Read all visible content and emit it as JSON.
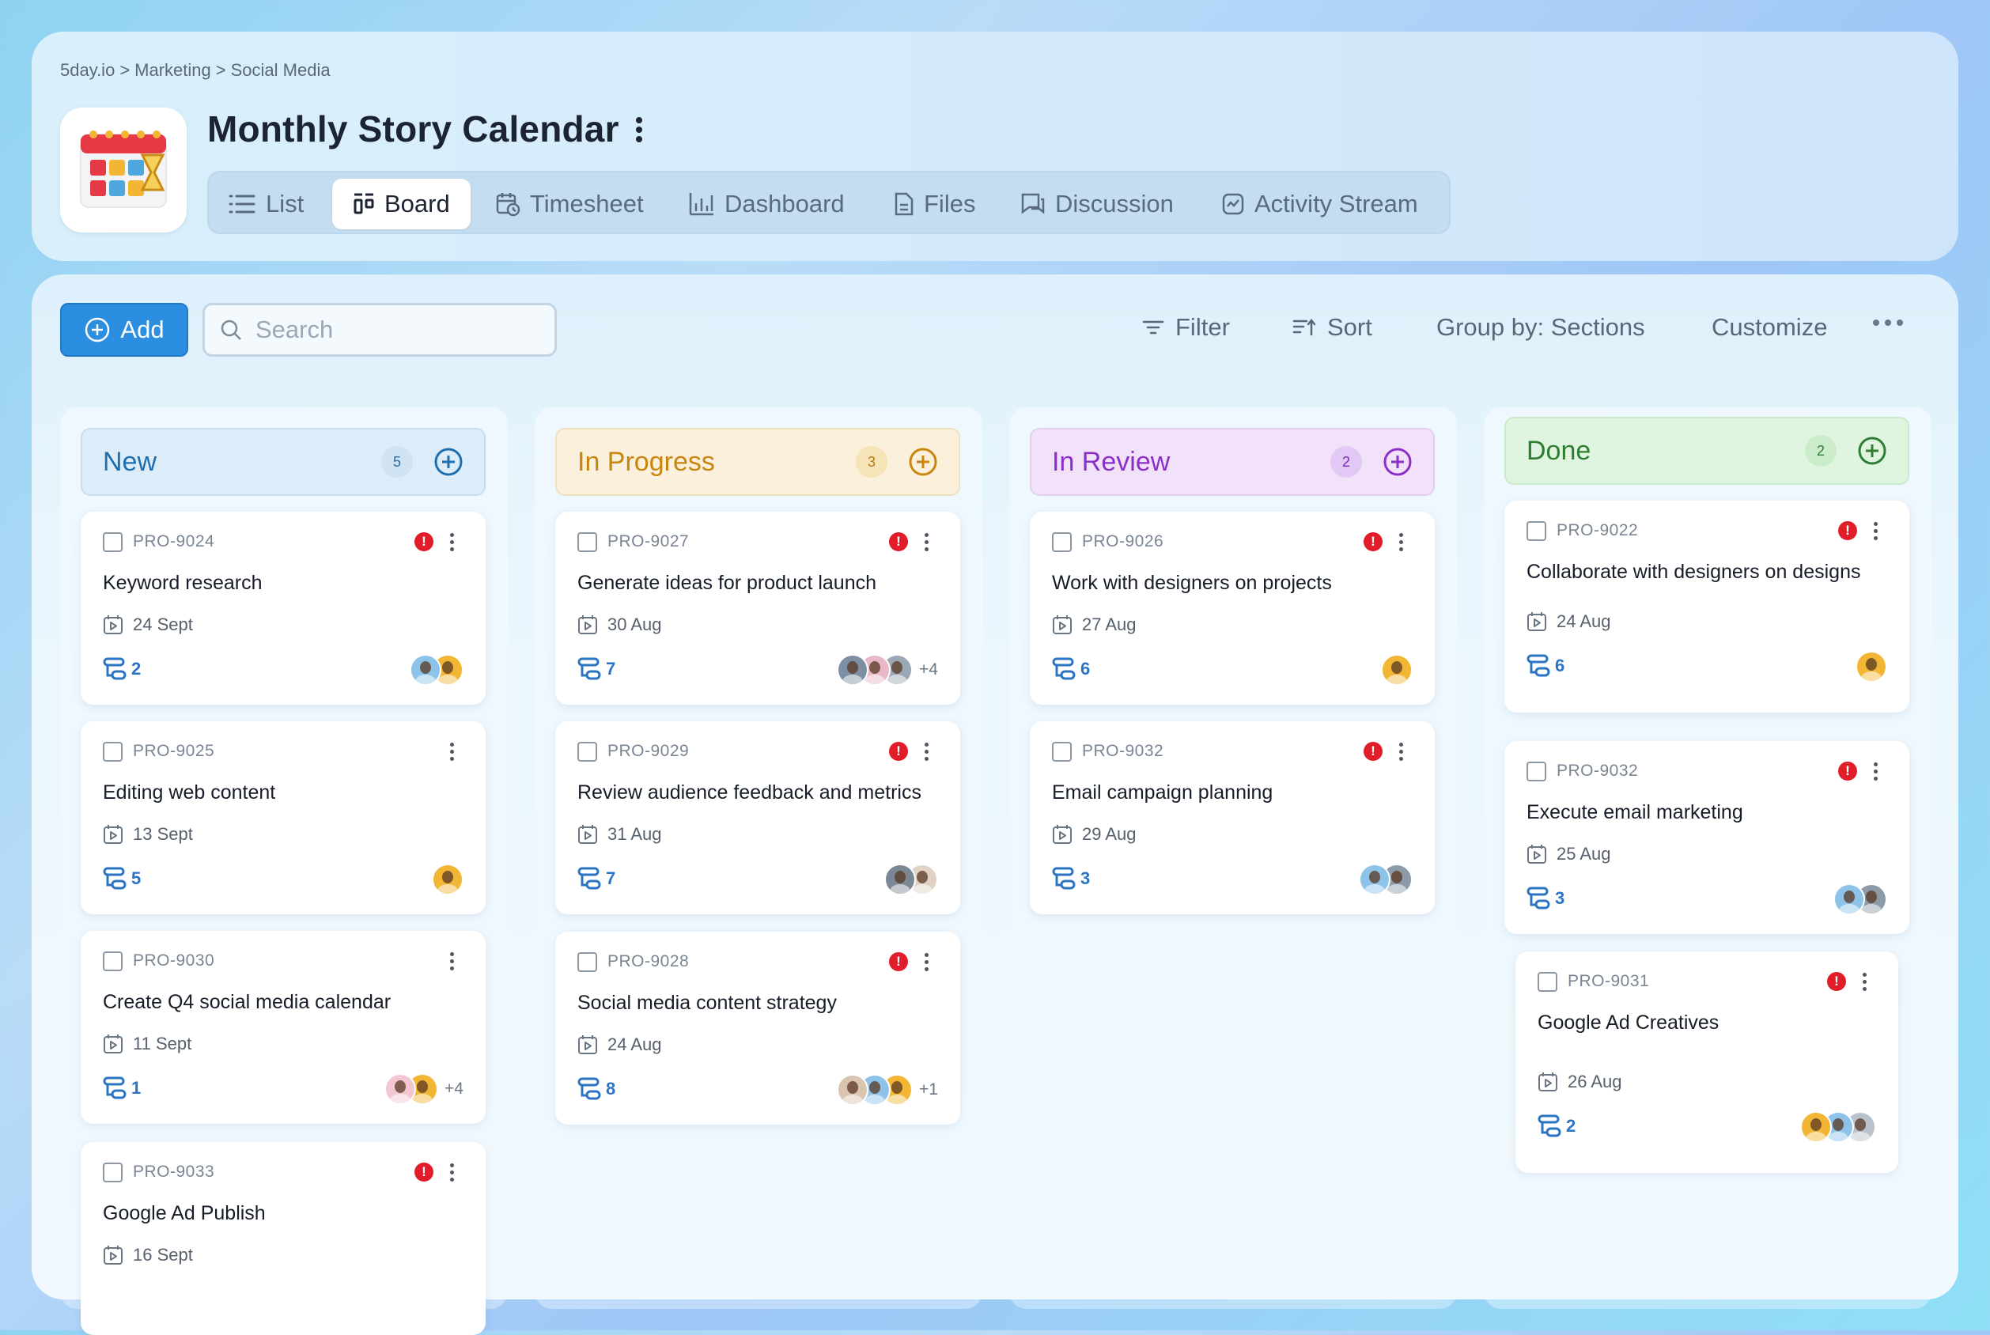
{
  "breadcrumb": [
    "5day.io",
    "Marketing",
    "Social Media"
  ],
  "breadcrumb_sep": ">",
  "page": {
    "title": "Monthly Story Calendar"
  },
  "tabs": [
    {
      "label": "List",
      "icon": "list-icon"
    },
    {
      "label": "Board",
      "icon": "board-icon",
      "active": true
    },
    {
      "label": "Timesheet",
      "icon": "timesheet-icon"
    },
    {
      "label": "Dashboard",
      "icon": "dashboard-icon"
    },
    {
      "label": "Files",
      "icon": "file-icon"
    },
    {
      "label": "Discussion",
      "icon": "discussion-icon"
    },
    {
      "label": "Activity Stream",
      "icon": "activity-icon"
    }
  ],
  "toolbar": {
    "add_label": "Add",
    "search_placeholder": "Search",
    "filter_label": "Filter",
    "sort_label": "Sort",
    "group_label": "Group by: Sections",
    "customize_label": "Customize"
  },
  "colors": {
    "accent": "#2c8ee0",
    "priority": "#e11d2a",
    "subtask": "#2b74c4"
  },
  "columns": [
    {
      "name": "New",
      "count": "5",
      "colors": {
        "bg": "#dcecf8",
        "border": "#c7def0",
        "text": "#1f6fb0",
        "badge_bg": "#cfe3f3",
        "badge_text": "#2a6fa5"
      },
      "cards": [
        {
          "id": "PRO-9024",
          "title": "Keyword research",
          "date": "24 Sept",
          "subtasks": "2",
          "priority": true,
          "avatars": [
            "#8dc3e8",
            "#f2b634"
          ],
          "more": ""
        },
        {
          "id": "PRO-9025",
          "title": "Editing web content",
          "date": "13 Sept",
          "subtasks": "5",
          "priority": false,
          "avatars": [
            "#f2b634"
          ],
          "more": ""
        },
        {
          "id": "PRO-9030",
          "title": "Create Q4 social media calendar",
          "date": "11 Sept",
          "subtasks": "1",
          "priority": false,
          "avatars": [
            "#f4c6d2",
            "#f2b634"
          ],
          "more": "+4"
        },
        {
          "id": "PRO-9033",
          "title": "Google Ad Publish",
          "date": "16 Sept",
          "subtasks": "",
          "priority": true,
          "avatars": [],
          "more": ""
        }
      ]
    },
    {
      "name": "In Progress",
      "count": "3",
      "colors": {
        "bg": "#faf0dc",
        "border": "#f1e1bd",
        "text": "#c8860f",
        "badge_bg": "#f6e3b8",
        "badge_text": "#b57a10"
      },
      "cards": [
        {
          "id": "PRO-9027",
          "title": "Generate ideas for product launch",
          "date": "30 Aug",
          "subtasks": "7",
          "priority": true,
          "avatars": [
            "#7d8fa3",
            "#e8b8c6",
            "#9aa7b4"
          ],
          "more": "+4"
        },
        {
          "id": "PRO-9029",
          "title": "Review audience feedback and metrics",
          "date": "31 Aug",
          "subtasks": "7",
          "priority": true,
          "avatars": [
            "#7b8794",
            "#e0d2c5"
          ],
          "more": ""
        },
        {
          "id": "PRO-9028",
          "title": "Social media content strategy",
          "date": "24 Aug",
          "subtasks": "8",
          "priority": true,
          "avatars": [
            "#d9c4b0",
            "#8dc3e8",
            "#f2b634"
          ],
          "more": "+1"
        }
      ]
    },
    {
      "name": "In Review",
      "count": "2",
      "colors": {
        "bg": "#f1e2fa",
        "border": "#e3cdf3",
        "text": "#8b2fc9",
        "badge_bg": "#e2c8f4",
        "badge_text": "#7a2db3"
      },
      "cards": [
        {
          "id": "PRO-9026",
          "title": "Work with designers on projects",
          "date": "27 Aug",
          "subtasks": "6",
          "priority": true,
          "avatars": [
            "#f2b634"
          ],
          "more": ""
        },
        {
          "id": "PRO-9032",
          "title": "Email campaign planning",
          "date": "29 Aug",
          "subtasks": "3",
          "priority": true,
          "avatars": [
            "#8dc3e8",
            "#8d9aa8"
          ],
          "more": ""
        }
      ]
    },
    {
      "name": "Done",
      "count": "2",
      "colors": {
        "bg": "#e0f5e0",
        "border": "#c9e9c9",
        "text": "#2f7d32",
        "badge_bg": "#cbeccb",
        "badge_text": "#2f7d32"
      },
      "cards": [
        {
          "id": "PRO-9022",
          "title": "Collaborate with designers on designs",
          "date": "24 Aug",
          "subtasks": "6",
          "priority": true,
          "avatars": [
            "#f2b634"
          ],
          "more": ""
        },
        {
          "id": "PRO-9032",
          "title": "Execute email marketing",
          "date": "25 Aug",
          "subtasks": "3",
          "priority": true,
          "avatars": [
            "#8dc3e8",
            "#8d9aa8"
          ],
          "more": ""
        },
        {
          "id": "PRO-9031",
          "title": "Google Ad Creatives",
          "date": "26 Aug",
          "subtasks": "2",
          "priority": true,
          "avatars": [
            "#f2b634",
            "#8dc3e8",
            "#b8c2cc"
          ],
          "more": ""
        }
      ]
    }
  ]
}
